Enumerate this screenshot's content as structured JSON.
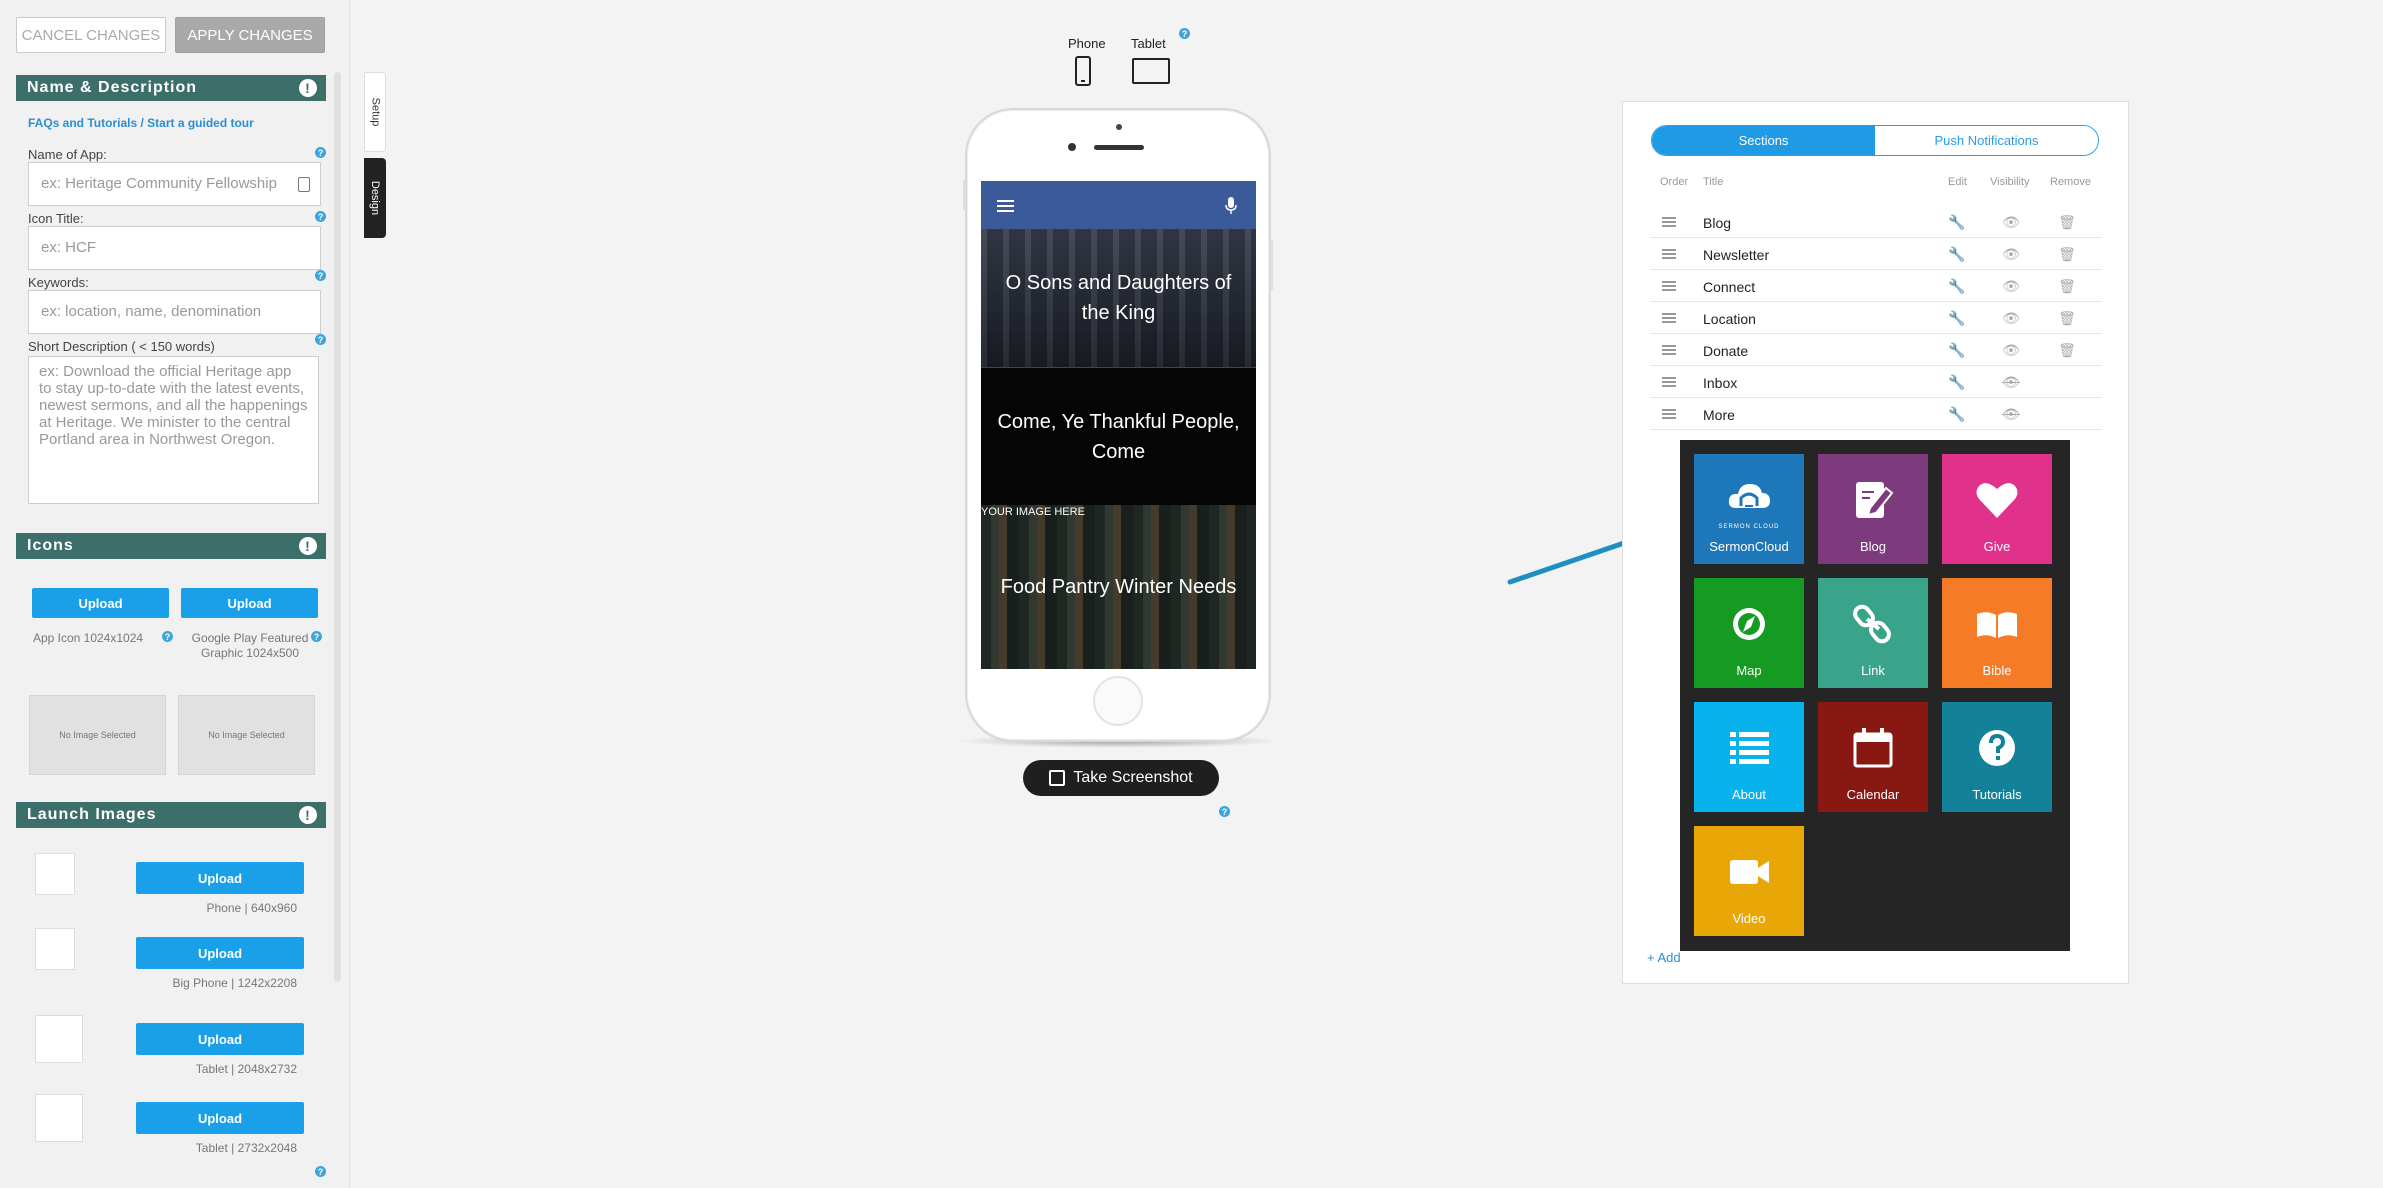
{
  "toolbar": {
    "cancel_label": "CANCEL CHANGES",
    "apply_label": "APPLY CHANGES"
  },
  "name_section": {
    "title": "Name & Description",
    "link_faq": "FAQs and Tutorials",
    "link_sep": " / ",
    "link_tour": "Start a guided tour",
    "app_name_label": "Name of App:",
    "app_name_placeholder": "ex: Heritage Community Fellowship",
    "icon_title_label": "Icon Title:",
    "icon_title_placeholder": "ex: HCF",
    "keywords_label": "Keywords:",
    "keywords_placeholder": "ex: location, name, denomination",
    "desc_label": "Short Description ( < 150 words)",
    "desc_placeholder": "ex: Download the official Heritage app to stay up-to-date with the latest events, newest sermons, and all the happenings at Heritage. We minister to the central Portland area in Northwest Oregon."
  },
  "icons_section": {
    "title": "Icons",
    "upload_label": "Upload",
    "app_icon_caption": "App Icon 1024x1024",
    "play_caption": "Google Play Featured Graphic 1024x500",
    "no_image": "No Image Selected"
  },
  "launch_section": {
    "title": "Launch Images",
    "upload_label": "Upload",
    "captions": [
      "Phone | 640x960",
      "Big Phone | 1242x2208",
      "Tablet | 2048x2732",
      "Tablet | 2732x2048"
    ]
  },
  "side_tabs": {
    "setup": "Setup",
    "design": "Design"
  },
  "device": {
    "phone_label": "Phone",
    "tablet_label": "Tablet",
    "cards": [
      "O Sons and Daughters of the King",
      "Come, Ye Thankful People, Come",
      "Food Pantry Winter Needs"
    ],
    "image_note": "YOUR IMAGE HERE",
    "screenshot_label": "Take Screenshot"
  },
  "sections_panel": {
    "tab_sections": "Sections",
    "tab_push": "Push Notifications",
    "col_order": "Order",
    "col_title": "Title",
    "col_edit": "Edit",
    "col_visibility": "Visibility",
    "col_remove": "Remove",
    "rows": [
      "Blog",
      "Newsletter",
      "Connect",
      "Location",
      "Donate",
      "Inbox",
      "More"
    ],
    "add_label": "+ Add"
  },
  "tiles": [
    {
      "label": "SermonCloud",
      "color": "#1e77b8",
      "icon": "cloud-icon",
      "sub": "SERMON CLOUD"
    },
    {
      "label": "Blog",
      "color": "#7d3a7d",
      "icon": "pencil-icon"
    },
    {
      "label": "Give",
      "color": "#e0318b",
      "icon": "heart-icon"
    },
    {
      "label": "Map",
      "color": "#159a22",
      "icon": "compass-icon"
    },
    {
      "label": "Link",
      "color": "#3aa48b",
      "icon": "link-icon"
    },
    {
      "label": "Bible",
      "color": "#f57b27",
      "icon": "book-icon"
    },
    {
      "label": "About",
      "color": "#08b2ec",
      "icon": "list-icon"
    },
    {
      "label": "Calendar",
      "color": "#8a1812",
      "icon": "calendar-icon"
    },
    {
      "label": "Tutorials",
      "color": "#138299",
      "icon": "question-icon"
    },
    {
      "label": "Video",
      "color": "#e9a607",
      "icon": "video-icon"
    }
  ],
  "help_glyph": "?",
  "alert_glyph": "!"
}
